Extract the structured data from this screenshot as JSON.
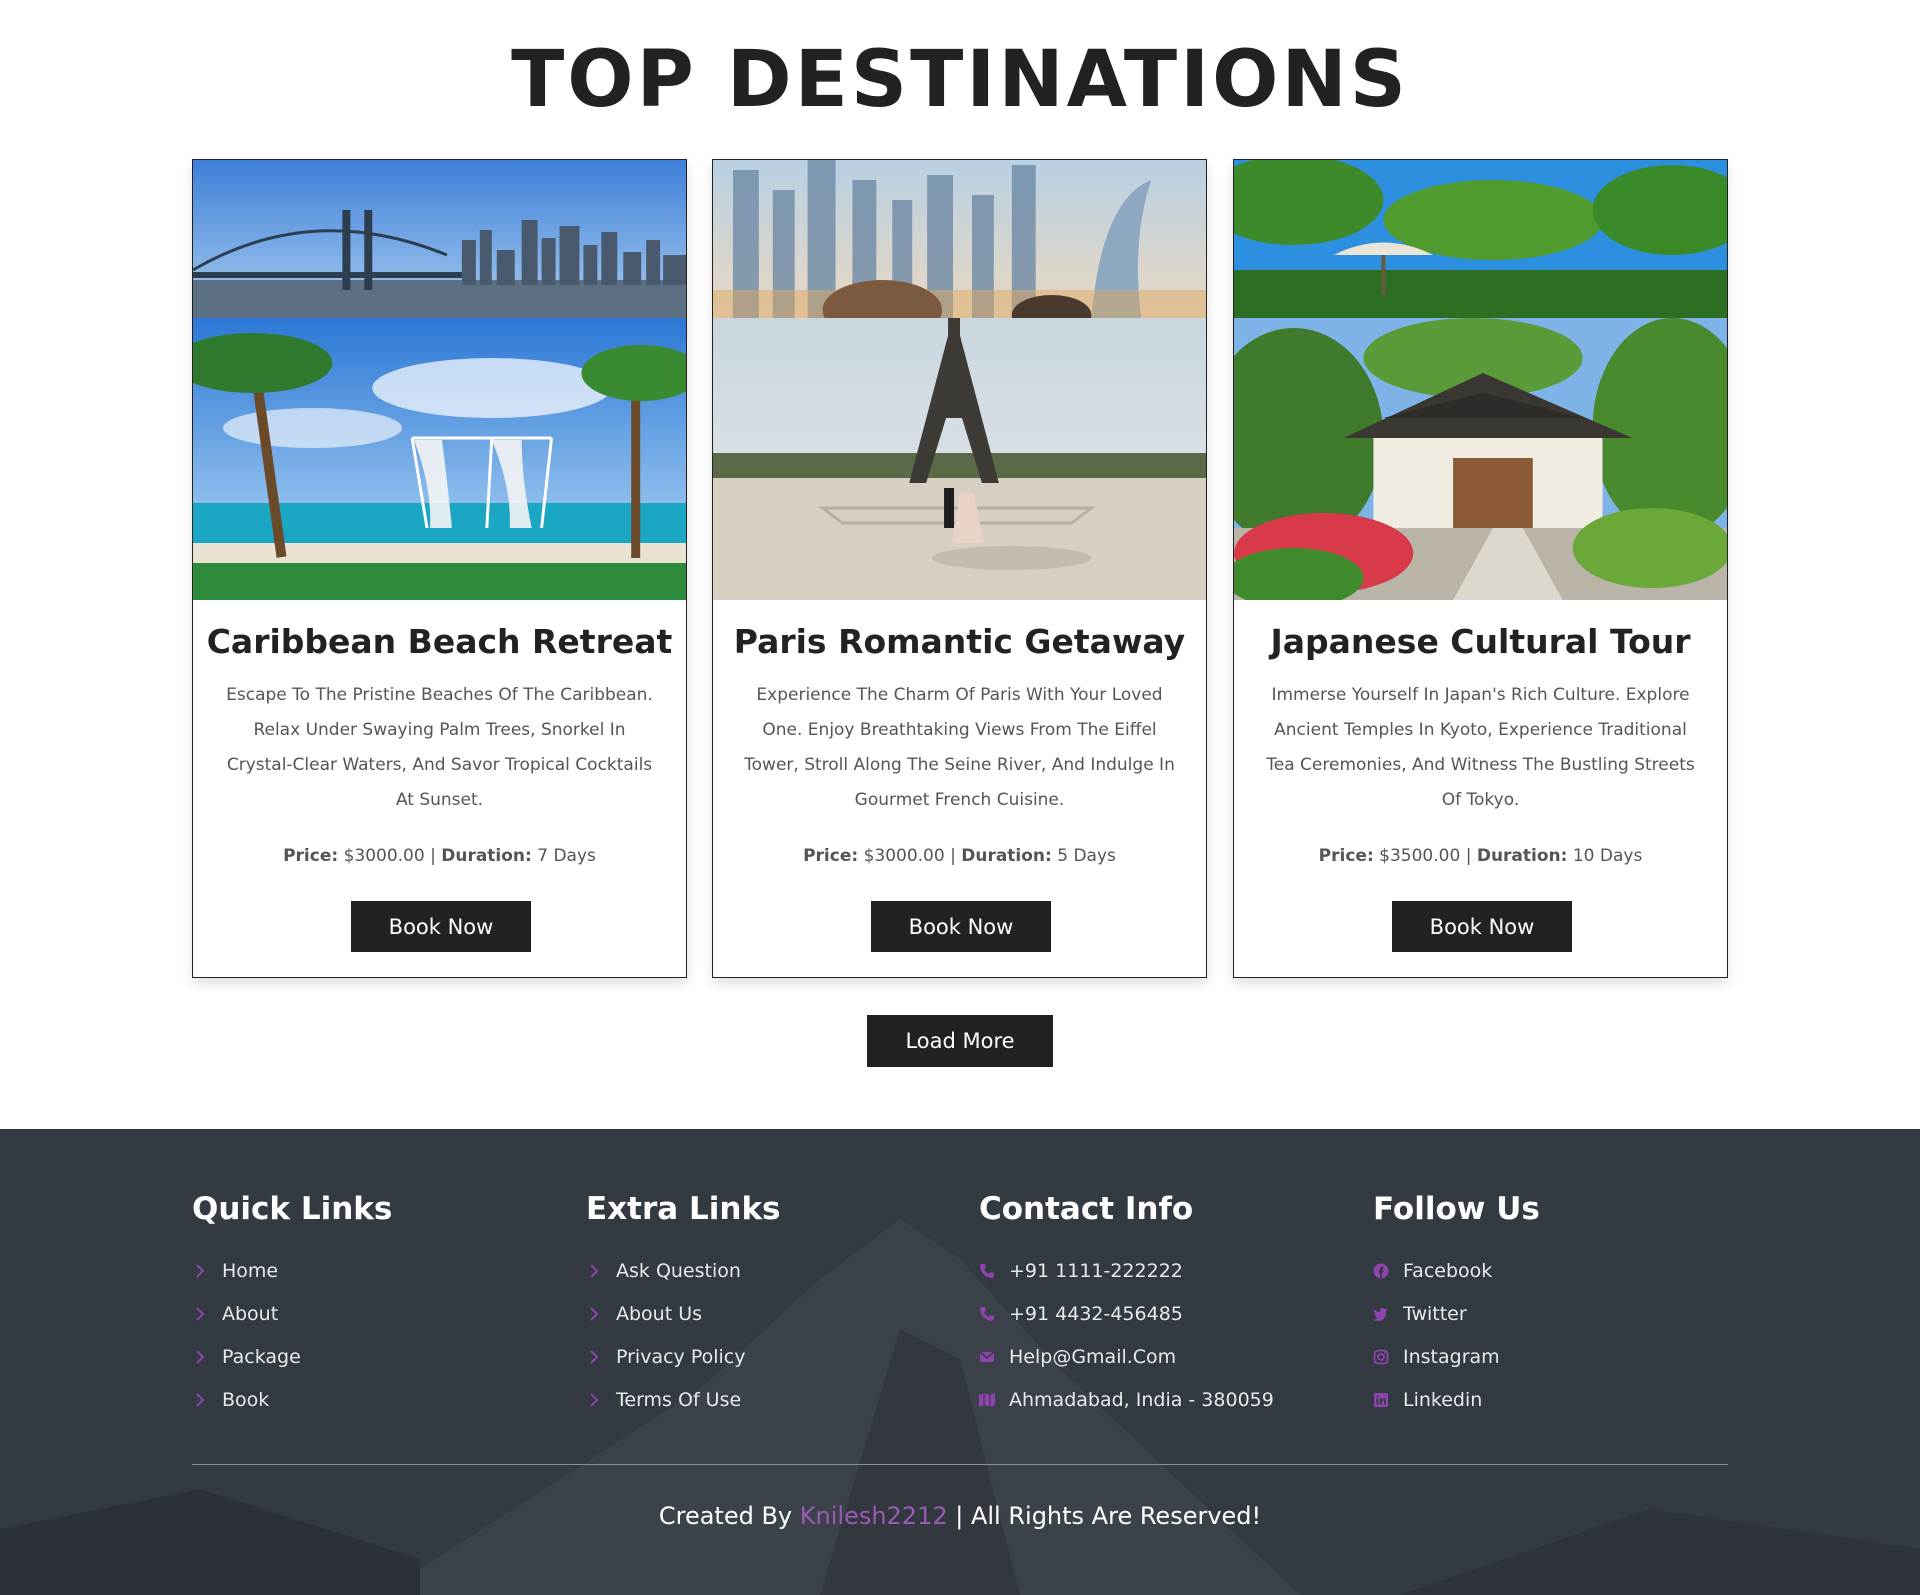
{
  "section": {
    "title": "TOP DESTINATIONS"
  },
  "cards": [
    {
      "title": "Caribbean Beach Retreat",
      "description": "Escape To The Pristine Beaches Of The Caribbean. Relax Under Swaying Palm Trees, Snorkel In Crystal-Clear Waters, And Savor Tropical Cocktails At Sunset.",
      "price_label": "Price:",
      "price": "$3000.00",
      "sep": "|",
      "duration_label": "Duration:",
      "duration": "7 Days",
      "button": "Book Now"
    },
    {
      "title": "Paris Romantic Getaway",
      "description": "Experience The Charm Of Paris With Your Loved One. Enjoy Breathtaking Views From The Eiffel Tower, Stroll Along The Seine River, And Indulge In Gourmet French Cuisine.",
      "price_label": "Price:",
      "price": "$3000.00",
      "sep": "|",
      "duration_label": "Duration:",
      "duration": "5 Days",
      "button": "Book Now"
    },
    {
      "title": "Japanese Cultural Tour",
      "description": "Immerse Yourself In Japan's Rich Culture. Explore Ancient Temples In Kyoto, Experience Traditional Tea Ceremonies, And Witness The Bustling Streets Of Tokyo.",
      "price_label": "Price:",
      "price": "$3500.00",
      "sep": "|",
      "duration_label": "Duration:",
      "duration": "10 Days",
      "button": "Book Now"
    }
  ],
  "load_more": "Load More",
  "footer": {
    "quick_links": {
      "title": "Quick Links",
      "items": [
        "Home",
        "About",
        "Package",
        "Book"
      ]
    },
    "extra_links": {
      "title": "Extra Links",
      "items": [
        "Ask Question",
        "About Us",
        "Privacy Policy",
        "Terms Of Use"
      ]
    },
    "contact": {
      "title": "Contact Info",
      "items": [
        {
          "icon": "phone-icon",
          "text": "+91 1111-222222"
        },
        {
          "icon": "phone-icon",
          "text": "+91 4432-456485"
        },
        {
          "icon": "envelope-icon",
          "text": "Help@Gmail.Com"
        },
        {
          "icon": "map-icon",
          "text": "Ahmadabad, India - 380059"
        }
      ]
    },
    "follow": {
      "title": "Follow Us",
      "items": [
        {
          "icon": "facebook-icon",
          "text": "Facebook"
        },
        {
          "icon": "twitter-icon",
          "text": "Twitter"
        },
        {
          "icon": "instagram-icon",
          "text": "Instagram"
        },
        {
          "icon": "linkedin-icon",
          "text": "Linkedin"
        }
      ]
    },
    "credit_prefix": "Created By",
    "credit_name": "Knilesh2212",
    "credit_suffix": "| All Rights Are Reserved!"
  },
  "colors": {
    "accent": "#8e44ad",
    "dark": "#222222",
    "footer_bg": "#343a42"
  }
}
